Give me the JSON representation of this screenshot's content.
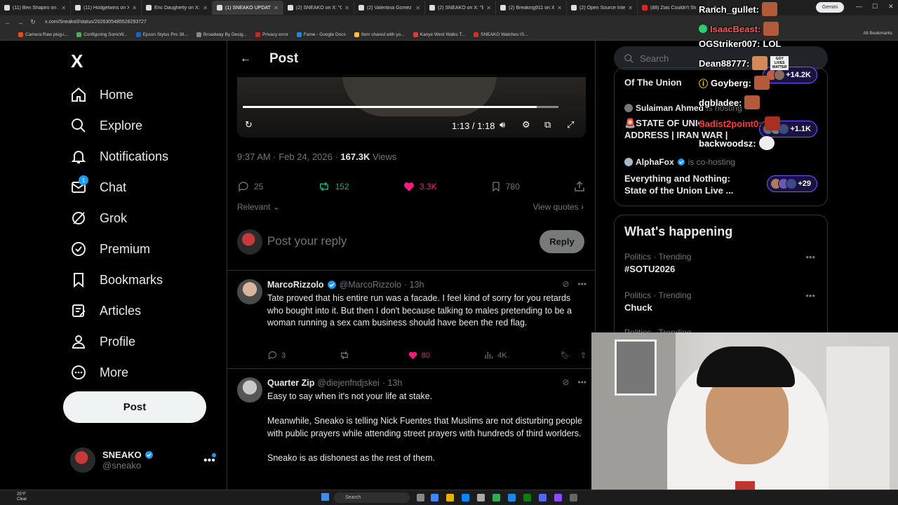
{
  "browser": {
    "tabs": [
      {
        "title": "(11) Ben Shapiro on X: \"",
        "active": false
      },
      {
        "title": "(11) Hodgetwins on X: \"",
        "active": false
      },
      {
        "title": "Eric Daugherty on X: \"",
        "active": false
      },
      {
        "title": "(1) SNEAKO UPDATES on",
        "active": true
      },
      {
        "title": "(2) SNEAKO on X: \"Cats",
        "active": false
      },
      {
        "title": "(2) Valentina Gomez on",
        "active": false
      },
      {
        "title": "(2) SNEAKO on X: \"Erika",
        "active": false
      },
      {
        "title": "(2) Breaking911 on X: \"",
        "active": false
      },
      {
        "title": "(2) Open Source Intel on",
        "active": false
      },
      {
        "title": "(88) Zias Couldn't Stop",
        "active": false
      }
    ],
    "gemini_label": "Gemini",
    "url": "x.com/Sneako0/status/2026305485528293727",
    "bookmarks": [
      "Camera Raw plug-i...",
      "Configuring SonicW...",
      "Epson Stylus Pro 38...",
      "Broadway By Desig...",
      "Privacy error",
      "Fame - Google Docs",
      "Item shared with yo...",
      "Kanye West Walks T...",
      "SNEAKO Watches IS..."
    ],
    "all_bookmarks": "All Bookmarks"
  },
  "nav": {
    "logo": "X",
    "items": [
      {
        "label": "Home",
        "icon": "home-icon"
      },
      {
        "label": "Explore",
        "icon": "search-icon"
      },
      {
        "label": "Notifications",
        "icon": "bell-icon"
      },
      {
        "label": "Chat",
        "icon": "mail-icon"
      },
      {
        "label": "Grok",
        "icon": "grok-icon"
      },
      {
        "label": "Premium",
        "icon": "premium-icon"
      },
      {
        "label": "Bookmarks",
        "icon": "bookmark-icon"
      },
      {
        "label": "Articles",
        "icon": "articles-icon"
      },
      {
        "label": "Profile",
        "icon": "person-icon"
      },
      {
        "label": "More",
        "icon": "more-icon"
      }
    ],
    "chat_badge": "1",
    "post_button": "Post",
    "profile": {
      "name": "SNEAKO",
      "handle": "@sneako"
    }
  },
  "post": {
    "header_title": "Post",
    "video": {
      "time": "1:13 / 1:18",
      "progress": 0.93
    },
    "timestamp": "9:37 AM · Feb 24, 2026 · ",
    "views_count": "167.3K",
    "views_label": " Views",
    "stats": {
      "replies": "25",
      "reposts": "152",
      "likes": "3.3K",
      "bookmarks": "780"
    },
    "sort_label": "Relevant",
    "view_quotes": "View quotes",
    "reply_placeholder": "Post your reply",
    "reply_button": "Reply"
  },
  "replies": [
    {
      "name": "MarcoRizzolo",
      "handle": "@MarcoRizzolo",
      "time": "· 13h",
      "body": "Tate proved that his entire run was a facade. I feel kind of sorry for you retards who bought into it. But then I don't because talking to males pretending to be a woman running a sex cam business should have been the red flag.",
      "replies": "3",
      "reposts": "",
      "likes": "80",
      "views": "4K"
    },
    {
      "name": "Quarter Zip",
      "handle": "@diejenfndjskei",
      "time": "· 13h",
      "body": "Easy to say when it's not your life at stake.\n\nMeanwhile, Sneako is telling Nick Fuentes that Muslims are not disturbing people with public prayers while attending street prayers with hundreds of third worlders.\n\nSneako is as dishonest as the rest of them."
    }
  ],
  "sidebar": {
    "search_placeholder": "Search",
    "spaces": [
      {
        "title_partial": "Of The Union",
        "count": "+14.2K"
      },
      {
        "host": "Sulaiman Ahmed",
        "role": "is hosting",
        "title": "🚨STATE OF UNIO... ADDRESS | IRAN WAR |",
        "count": "+1.1K"
      },
      {
        "host": "AlphaFox",
        "role": "is co-hosting",
        "title": "Everything and Nothing: State of the Union Live ...",
        "count": "+29"
      }
    ],
    "happening_title": "What's happening",
    "trends": [
      {
        "category": "Politics · Trending",
        "name": "#SOTU2026"
      },
      {
        "category": "Politics · Trending",
        "name": "Chuck"
      },
      {
        "category": "Politics · Trending",
        "name": ""
      }
    ]
  },
  "chat_overlay": [
    {
      "user": "Ranch_gullet:",
      "msg": ""
    },
    {
      "user": "IsaacBeast:",
      "msg": ""
    },
    {
      "user": "OGStriker007:",
      "msg": "LOL"
    },
    {
      "user": "Dean88777:",
      "msg": ""
    },
    {
      "user": "Goyberg:",
      "msg": ""
    },
    {
      "user": "dgbladee:",
      "msg": ""
    },
    {
      "user": "Sadist2point0:",
      "msg": ""
    },
    {
      "user": "backwoodsz:",
      "msg": ""
    }
  ],
  "chat_stickers": [
    "GOY LIVES MATTER"
  ],
  "taskbar": {
    "temp": "25°F",
    "condition": "Clear",
    "search": "Search"
  },
  "colors": {
    "accent": "#1d9bf0",
    "like": "#f91880",
    "repost": "#00ba7c",
    "spaces": "#7856ff"
  }
}
